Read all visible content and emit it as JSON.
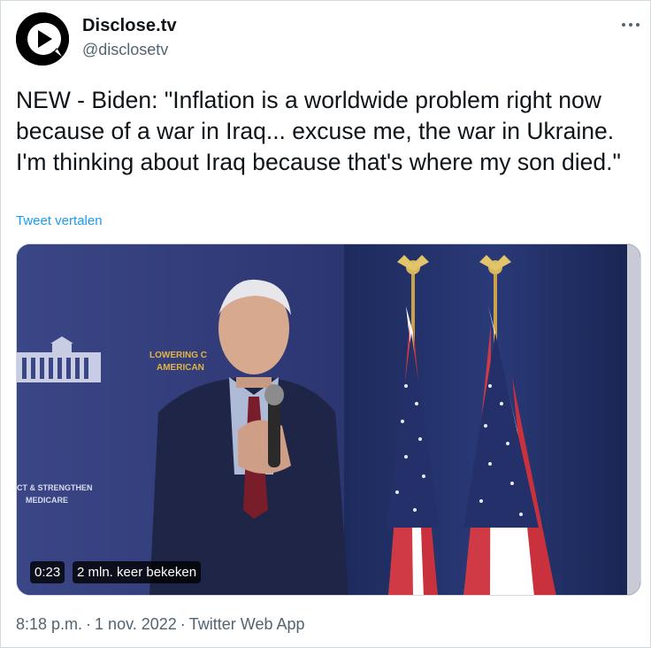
{
  "account": {
    "display_name": "Disclose.tv",
    "handle": "@disclosetv"
  },
  "tweet": {
    "text": "NEW - Biden: \"Inflation is a worldwide problem right now because of a war in Iraq... excuse me, the war in Ukraine. I'm thinking about Iraq because that's where my son died.\"",
    "translate_label": "Tweet vertalen"
  },
  "video": {
    "duration": "0:23",
    "views": "2 mln. keer bekeken",
    "backdrop_text_top": [
      "LOWERING C",
      "AMERICAN"
    ],
    "backdrop_text_bottom": [
      "CT & STRENGTHEN",
      "MEDICARE"
    ]
  },
  "meta": {
    "time": "8:18 p.m.",
    "date": "1 nov. 2022",
    "source": "Twitter Web App",
    "separator": "·"
  },
  "colors": {
    "link": "#1d9bf0",
    "secondary_text": "#536471",
    "border": "#cfd9de"
  },
  "icons": {
    "avatar": "disclose-play-logo",
    "more": "more-dots-icon"
  }
}
